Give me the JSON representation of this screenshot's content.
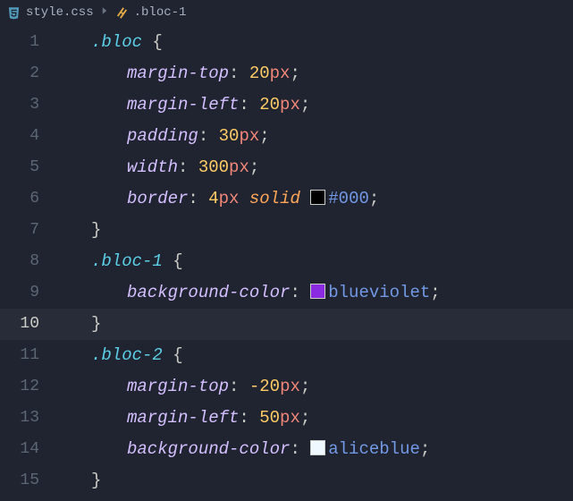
{
  "breadcrumbs": {
    "file": "style.css",
    "symbol": ".bloc-1"
  },
  "editor": {
    "current_line": 10,
    "line_count": 15,
    "rules": [
      {
        "selector": ".bloc",
        "open_line": 1,
        "close_line": 7,
        "decls": [
          {
            "line": 2,
            "prop": "margin-top",
            "value_num": "20",
            "value_unit": "px"
          },
          {
            "line": 3,
            "prop": "margin-left",
            "value_num": "20",
            "value_unit": "px"
          },
          {
            "line": 4,
            "prop": "padding",
            "value_num": "30",
            "value_unit": "px"
          },
          {
            "line": 5,
            "prop": "width",
            "value_num": "300",
            "value_unit": "px"
          },
          {
            "line": 6,
            "prop": "border",
            "border_num": "4",
            "border_unit": "px",
            "border_style": "solid",
            "swatch": "sw-black",
            "color_text": "#000"
          }
        ]
      },
      {
        "selector": ".bloc-1",
        "open_line": 8,
        "close_line": 10,
        "decls": [
          {
            "line": 9,
            "prop": "background-color",
            "swatch": "sw-blueviolet",
            "color_text": "blueviolet"
          }
        ]
      },
      {
        "selector": ".bloc-2",
        "open_line": 11,
        "close_line": 15,
        "decls": [
          {
            "line": 12,
            "prop": "margin-top",
            "value_num": "-20",
            "value_unit": "px"
          },
          {
            "line": 13,
            "prop": "margin-left",
            "value_num": "50",
            "value_unit": "px"
          },
          {
            "line": 14,
            "prop": "background-color",
            "swatch": "sw-aliceblue",
            "color_text": "aliceblue"
          }
        ]
      }
    ]
  }
}
